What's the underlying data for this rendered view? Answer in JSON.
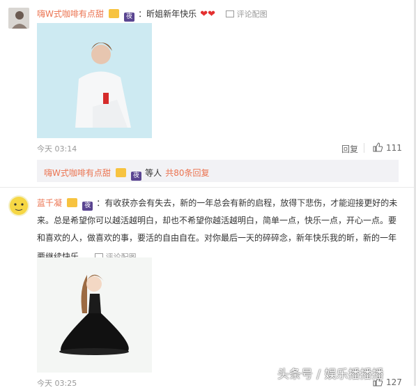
{
  "comment1": {
    "username": "嗨W式咖啡有点甜",
    "badge_night": "夜",
    "text": "：昕姐新年快乐",
    "hearts": "❤❤",
    "image_reply_link": "评论配图",
    "timestamp": "今天 03:14",
    "reply_label": "回复",
    "like_count": "111"
  },
  "sub_reply": {
    "username": "嗨W式咖啡有点甜",
    "badge_night": "夜",
    "mid_text": "等人",
    "count_text": "共80条回复"
  },
  "comment2": {
    "username": "蓝千凝",
    "badge_night": "夜",
    "text_line1": "：有收获亦会有失去，新的一年总会有新的启程，放得下悲伤，才能迎接更好的未",
    "text_line2": "来。总是希望你可以越活越明白，却也不希望你越活越明白，简单一点，快乐一点，开心一点。要",
    "text_line3": "和喜欢的人，做喜欢的事，要活的自由自在。对你最后一天的碎碎念，新年快乐我的昕，新的一年",
    "text_line4": "要继续快乐。",
    "image_reply_link": "评论配图",
    "timestamp": "今天 03:25",
    "like_count": "127"
  },
  "watermark": "头条号 / 娱乐播播播",
  "colors": {
    "username": "#eb7350",
    "subreply_bg": "#f2f2f5",
    "photo_bg": "#cdeaf2"
  }
}
